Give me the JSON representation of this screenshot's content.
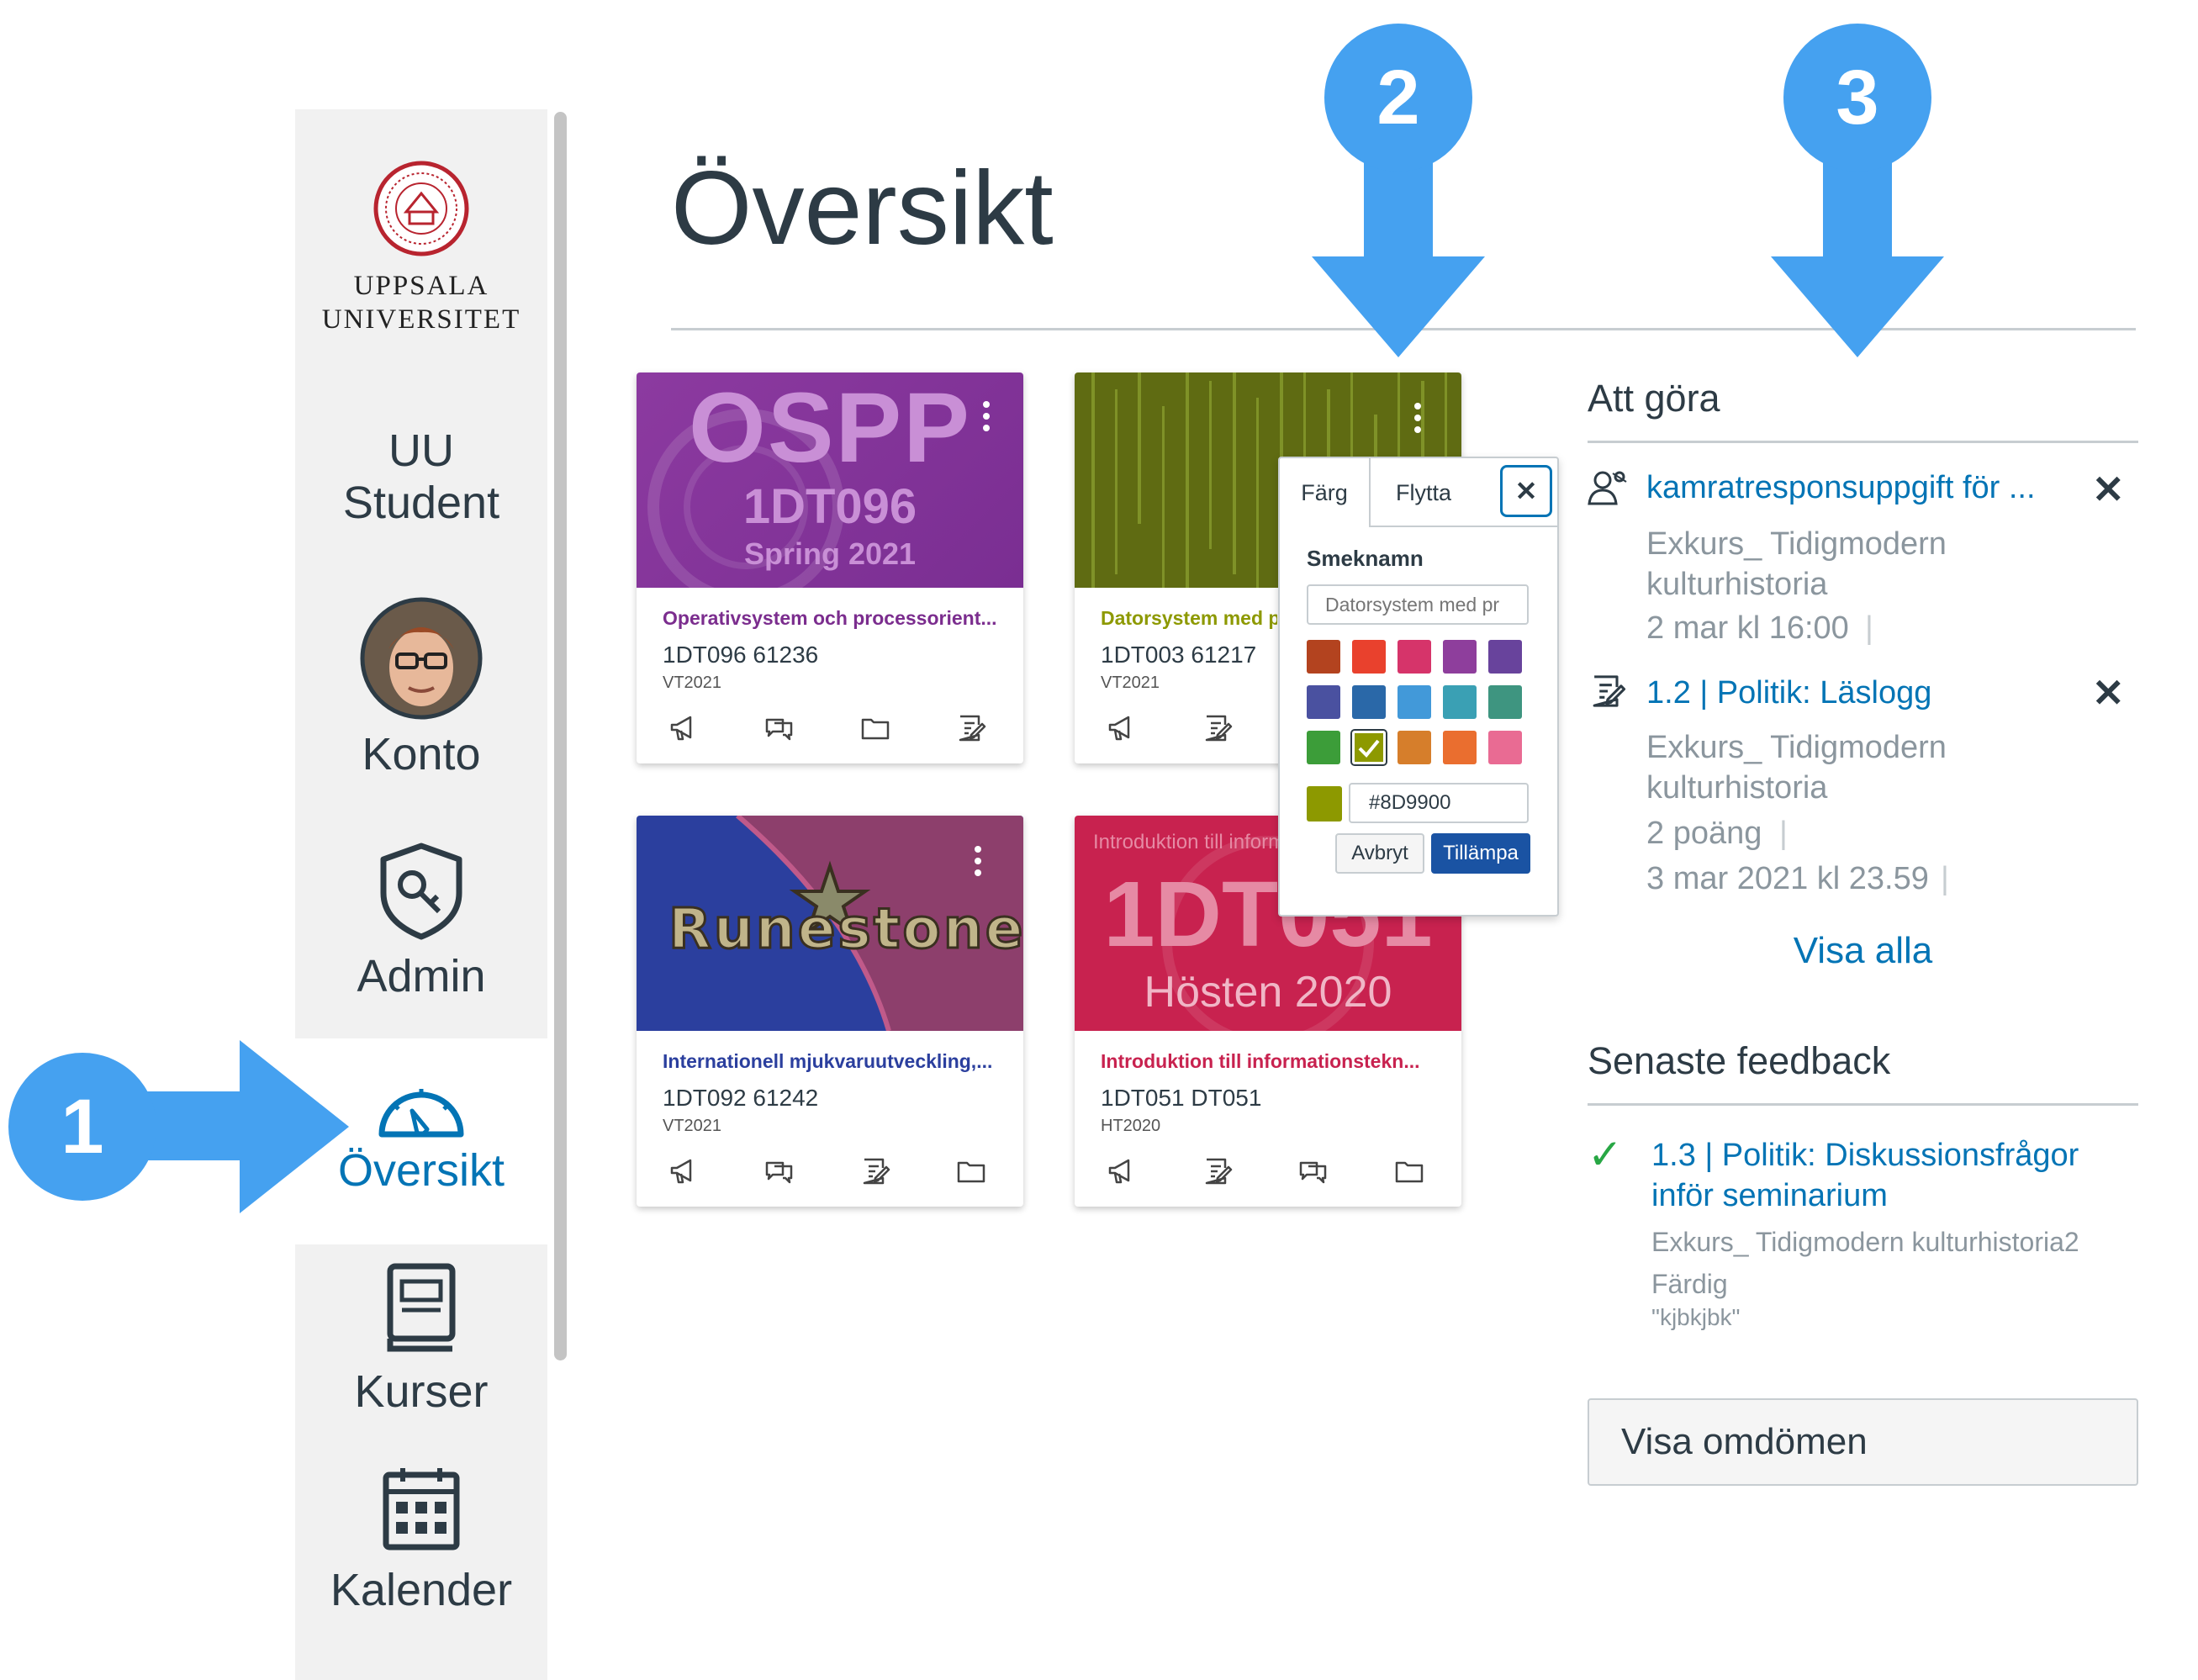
{
  "nav": {
    "university_line1": "UPPSALA",
    "university_line2": "UNIVERSITET",
    "uu_student_line1": "UU",
    "uu_student_line2": "Student",
    "konto": "Konto",
    "admin": "Admin",
    "oversikt": "Översikt",
    "kurser": "Kurser",
    "kalender": "Kalender",
    "active_color": "#0374b5"
  },
  "page": {
    "title": "Översikt"
  },
  "cards": [
    {
      "hero_big": "OSPP",
      "hero_mid": "1DT096",
      "hero_small": "Spring 2021",
      "name": "Operativsystem och processorient...",
      "code": "1DT096 61236",
      "term": "VT2021",
      "color": "#7b2d8e",
      "icons": [
        "announcement-icon",
        "discussion-icon",
        "folder-icon",
        "assignment-icon"
      ]
    },
    {
      "name": "Datorsystem med programmering",
      "code": "1DT003 61217",
      "term": "VT2021",
      "color": "#8d9900",
      "icons": [
        "announcement-icon",
        "assignment-icon"
      ]
    },
    {
      "hero_word": "Runestone",
      "name": "Internationell mjukvaruutveckling,...",
      "code": "1DT092 61242",
      "term": "VT2021",
      "color": "#2b3f9e",
      "icons": [
        "announcement-icon",
        "discussion-icon",
        "assignment-icon",
        "folder-icon"
      ]
    },
    {
      "hero_top": "Introduktion till informationsteknologi",
      "hero_big": "1DT051",
      "hero_small": "Hösten 2020",
      "name": "Introduktion till informationstekn...",
      "code": "1DT051 DT051",
      "term": "HT2020",
      "color": "#c8224f",
      "icons": [
        "announcement-icon",
        "assignment-icon",
        "discussion-icon",
        "folder-icon"
      ]
    }
  ],
  "popover": {
    "tab_color": "Färg",
    "tab_move": "Flytta",
    "close": "✕",
    "nickname_label": "Smeknamn",
    "nickname_placeholder": "Datorsystem med pr",
    "swatches": [
      "#b3431f",
      "#e9412d",
      "#d6346a",
      "#8e3e9c",
      "#68439c",
      "#4a51a0",
      "#2a68a8",
      "#4299d9",
      "#3aa0b4",
      "#3e9580",
      "#3c9d39",
      "#8d9900",
      "#d67e2b",
      "#ea6e2f",
      "#e96b93"
    ],
    "hex_value": "#8D9900",
    "cancel": "Avbryt",
    "apply": "Tillämpa"
  },
  "todo": {
    "heading": "Att göra",
    "items": [
      {
        "title": "kamratresponsuppgift för ...",
        "course_line1": "Exkurs_ Tidigmodern",
        "course_line2": "kulturhistoria",
        "meta": "2 mar kl 16:00",
        "meta_sep": "|"
      },
      {
        "title": "1.2 | Politik: Läslogg",
        "course_line1": "Exkurs_ Tidigmodern",
        "course_line2": "kulturhistoria",
        "points": "2 poäng",
        "points_sep": "|",
        "meta": "3 mar 2021 kl 23.59",
        "meta_sep": "|"
      }
    ],
    "dismiss": "✕",
    "show_all": "Visa alla"
  },
  "feedback": {
    "heading": "Senaste feedback",
    "check": "✓",
    "title_line1": "1.3 | Politik: Diskussionsfrågor",
    "title_line2": "inför seminarium",
    "course": "Exkurs_ Tidigmodern kulturhistoria2",
    "status": "Färdig",
    "comment": "\"kjbkjbk\"",
    "button": "Visa omdömen"
  },
  "annotations": {
    "one": "1",
    "two": "2",
    "three": "3",
    "color": "#45a1f0"
  }
}
